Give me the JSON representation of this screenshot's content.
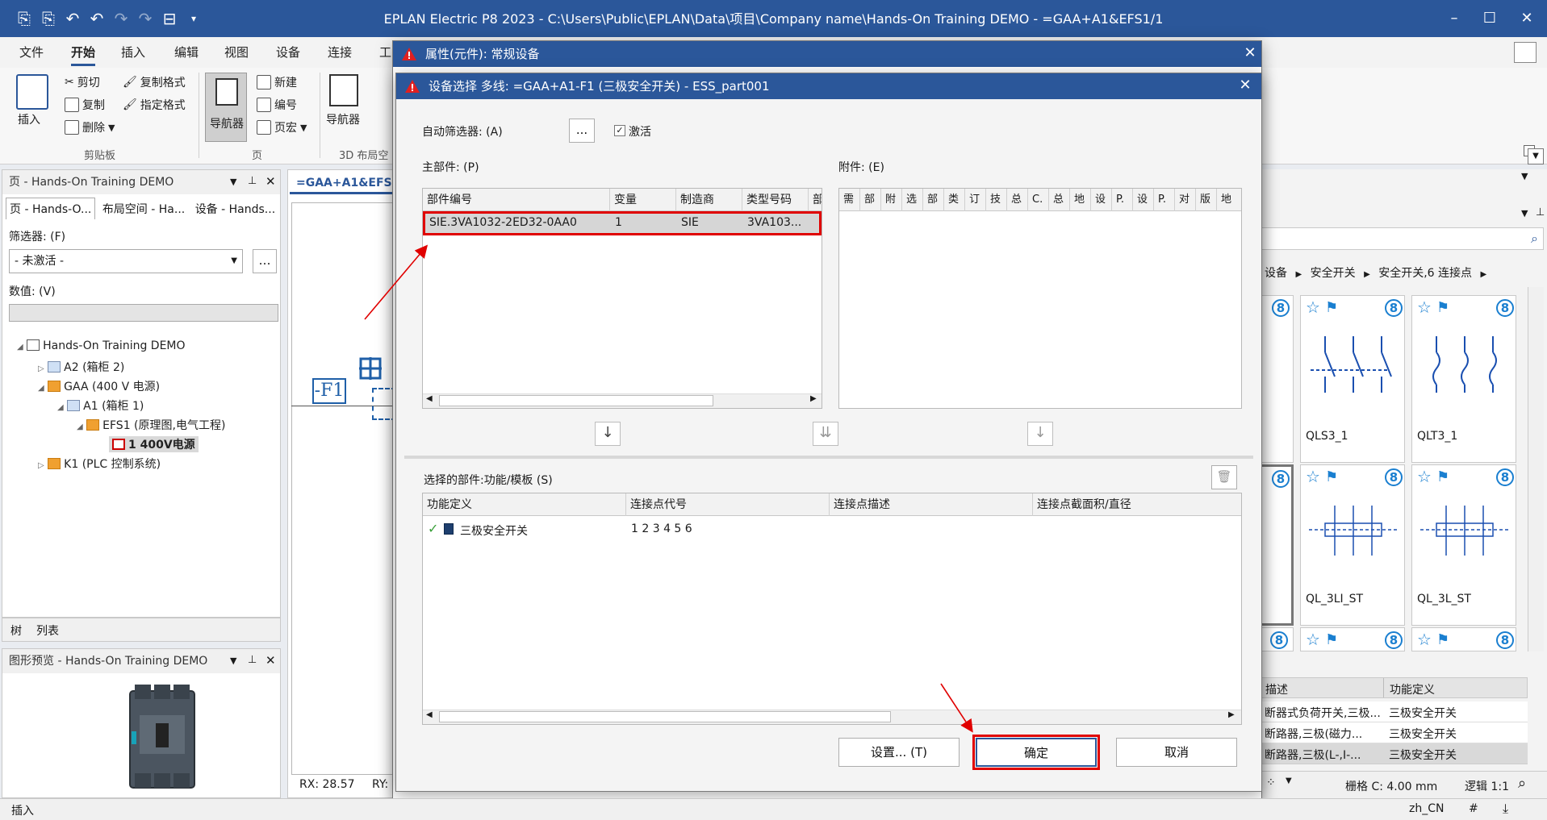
{
  "window": {
    "title": "EPLAN Electric P8 2023 - C:\\Users\\Public\\EPLAN\\Data\\项目\\Company name\\Hands-On Training DEMO - =GAA+A1&EFS1/1"
  },
  "ribbon": {
    "tabs": [
      "文件",
      "开始",
      "插入",
      "编辑",
      "视图",
      "设备",
      "连接",
      "工"
    ],
    "clipboard": {
      "insert": "插入",
      "cut": "剪切",
      "copy": "复制",
      "delete": "删除",
      "copy_format": "复制格式",
      "assign_format": "指定格式",
      "group": "剪贴板"
    },
    "page": {
      "navigator": "导航器",
      "new": "新建",
      "number": "编号",
      "macro": "页宏",
      "group": "页"
    },
    "layout3d": {
      "navigator": "导航器",
      "group": "3D 布局空"
    }
  },
  "left_panel": {
    "title": "页 - Hands-On Training DEMO",
    "tabs": [
      "页 - Hands-O...",
      "布局空间 - Ha...",
      "设备 - Hands..."
    ],
    "filter_label": "筛选器: (F)",
    "filter_value": "- 未激活 -",
    "values_label": "数值: (V)",
    "tree": [
      {
        "label": "Hands-On Training DEMO"
      },
      {
        "label": "A2 (箱柜 2)"
      },
      {
        "label": "GAA (400 V 电源)"
      },
      {
        "label": "A1 (箱柜 1)"
      },
      {
        "label": "EFS1 (原理图,电气工程)"
      },
      {
        "label": "1 400V电源"
      },
      {
        "label": "K1 (PLC 控制系统)"
      }
    ],
    "bottom_tabs": [
      "树",
      "列表"
    ]
  },
  "preview_panel": {
    "title": "图形预览 - Hands-On Training DEMO"
  },
  "doc_tab": {
    "label": "=GAA+A1&EFS1"
  },
  "canvas": {
    "device_label": "-F1",
    "rx": "RX: 28.57",
    "ry": "RY:"
  },
  "prop_dialog": {
    "title": "属性(元件): 常规设备"
  },
  "device_dialog": {
    "title": "设备选择 多线: =GAA+A1-F1 (三极安全开关) - ESS_part001",
    "auto_filter_label": "自动筛选器: (A)",
    "auto_filter_btn": "...",
    "activate_label": "激活",
    "main_parts_label": "主部件: (P)",
    "accessories_label": "附件: (E)",
    "main_columns": [
      "部件编号",
      "变量",
      "制造商",
      "类型号码",
      "部"
    ],
    "main_rows": [
      {
        "part_no": "SIE.3VA1032-2ED32-0AA0",
        "variant": "1",
        "manufacturer": "SIE",
        "type": "3VA103..."
      }
    ],
    "acc_columns": [
      "需",
      "部",
      "附",
      "选",
      "部",
      "类",
      "订",
      "技",
      "总",
      "C.",
      "总",
      "地",
      "设",
      "P.",
      "设",
      "P.",
      "对",
      "版",
      "地"
    ],
    "selected_label": "选择的部件:功能/模板 (S)",
    "sel_columns": [
      "功能定义",
      "连接点代号",
      "连接点描述",
      "连接点截面积/直径"
    ],
    "sel_rows": [
      {
        "function": "三极安全开关",
        "points": "1 2 3 4 5 6"
      }
    ],
    "buttons": {
      "settings": "设置... (T)",
      "ok": "确定",
      "cancel": "取消"
    }
  },
  "right_panel": {
    "breadcrumb": [
      "设备",
      "安全开关",
      "安全开关,6 连接点"
    ],
    "tiles": [
      {
        "name": "QLS3_1"
      },
      {
        "name": "QLT3_1"
      },
      {
        "name": "QL_3LI_ST"
      },
      {
        "name": "QL_3L_ST"
      }
    ],
    "table_headers": [
      "描述",
      "功能定义"
    ],
    "table_rows": [
      {
        "desc": "断器式负荷开关,三极...",
        "func": "三极安全开关"
      },
      {
        "desc": "断路器,三极(磁力...",
        "func": "三极安全开关"
      },
      {
        "desc": "断路器,三极(L-,I-...",
        "func": "三极安全开关"
      }
    ]
  },
  "statusbar": {
    "left": "插入",
    "grid": "栅格 C: 4.00 mm",
    "logic": "逻辑 1:1",
    "locale": "zh_CN",
    "hash": "#"
  },
  "colors": {
    "accent": "#2b579a",
    "highlight_box": "#e00000",
    "icon_blue": "#1a7fd0"
  }
}
